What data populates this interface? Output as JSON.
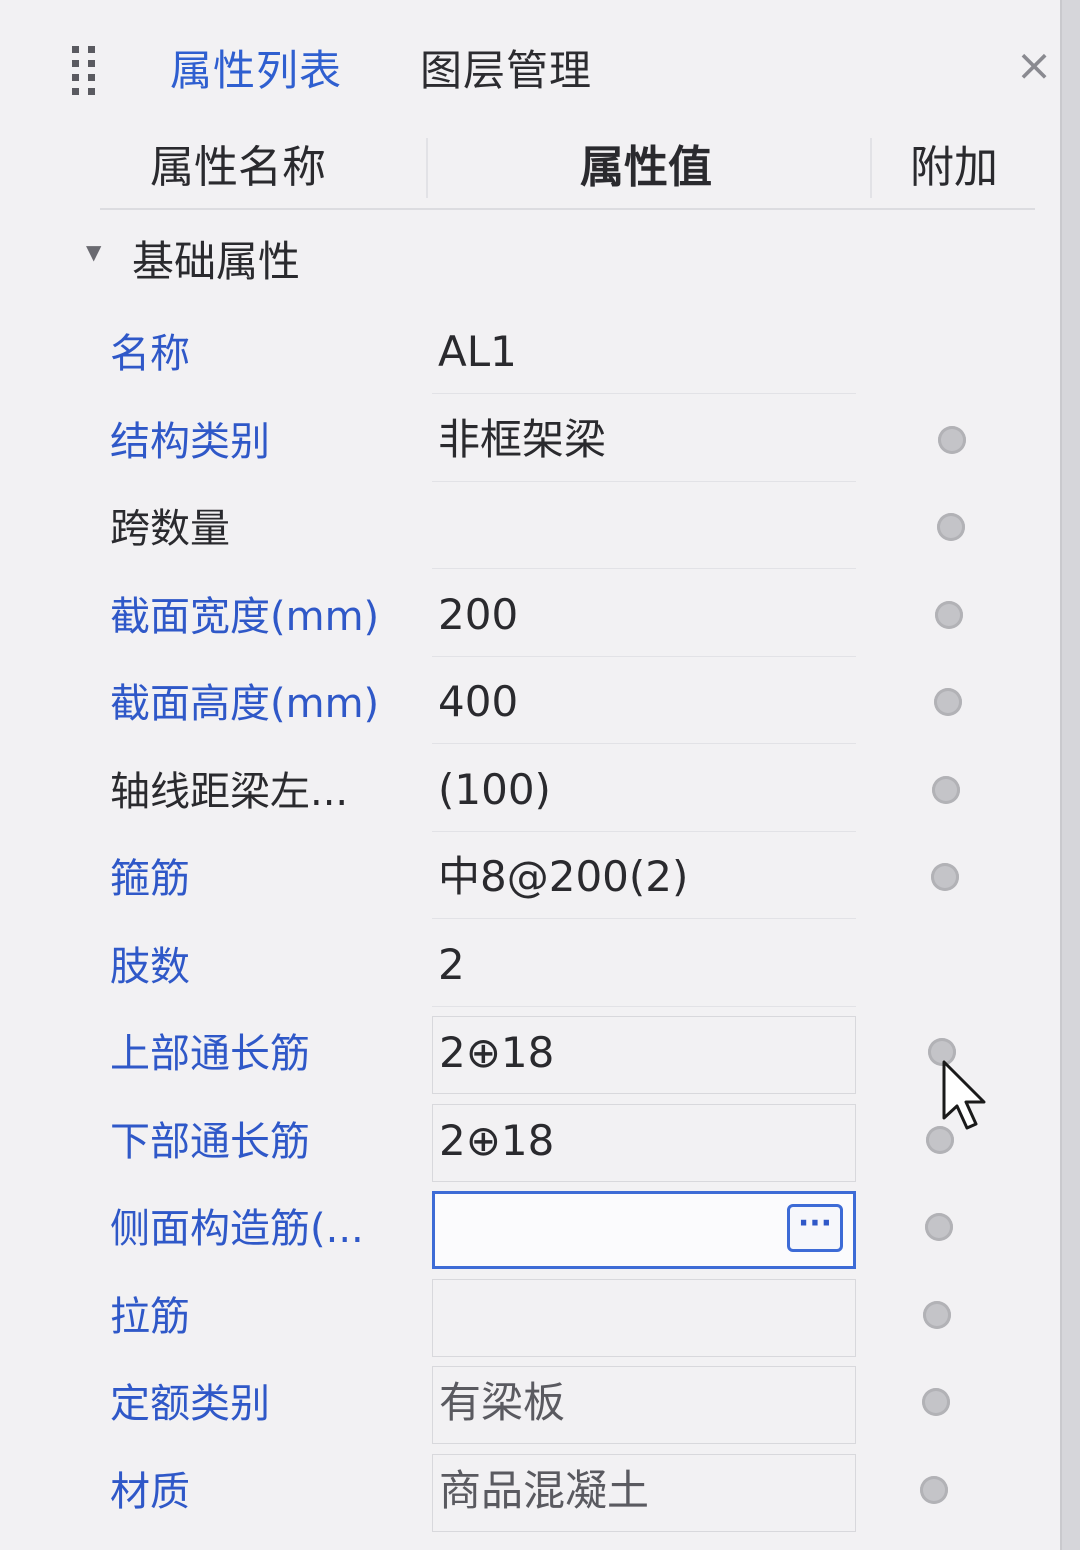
{
  "tabs": [
    {
      "label": "属性列表",
      "active": true
    },
    {
      "label": "图层管理",
      "active": false
    }
  ],
  "columns": {
    "name": "属性名称",
    "value": "属性值",
    "extra": "附加"
  },
  "group": {
    "label": "基础属性",
    "expanded": true
  },
  "properties": [
    {
      "name": "名称",
      "value": "AL1",
      "name_color": "blue",
      "has_extra": false
    },
    {
      "name": "结构类别",
      "value": "非框架梁",
      "name_color": "blue",
      "has_extra": true
    },
    {
      "name": "跨数量",
      "value": "",
      "name_color": "black",
      "has_extra": true
    },
    {
      "name": "截面宽度(mm)",
      "value": "200",
      "name_color": "blue",
      "has_extra": true
    },
    {
      "name": "截面高度(mm)",
      "value": "400",
      "name_color": "blue",
      "has_extra": true
    },
    {
      "name": "轴线距梁左...",
      "value": "(100)",
      "name_color": "black",
      "has_extra": true
    },
    {
      "name": "箍筋",
      "value": "中8@200(2)",
      "name_color": "blue",
      "has_extra": true
    },
    {
      "name": "肢数",
      "value": "2",
      "name_color": "blue",
      "has_extra": false
    },
    {
      "name": "上部通长筋",
      "value": "2⊕18",
      "name_color": "blue",
      "has_extra": true
    },
    {
      "name": "下部通长筋",
      "value": "2⊕18",
      "name_color": "blue",
      "has_extra": true
    },
    {
      "name": "侧面构造筋(...",
      "value": "",
      "name_color": "blue",
      "has_extra": true,
      "editing": true,
      "button_label": "···"
    },
    {
      "name": "拉筋",
      "value": "",
      "name_color": "blue",
      "has_extra": true
    },
    {
      "name": "定额类别",
      "value": "有梁板",
      "name_color": "blue",
      "has_extra": true
    },
    {
      "name": "材质",
      "value": "商品混凝土",
      "name_color": "blue",
      "has_extra": true
    }
  ],
  "close_label": "×",
  "colors": {
    "accent": "#2f58c8",
    "panel_bg": "#f2f1f3",
    "edit_border": "#3d6bd6"
  }
}
